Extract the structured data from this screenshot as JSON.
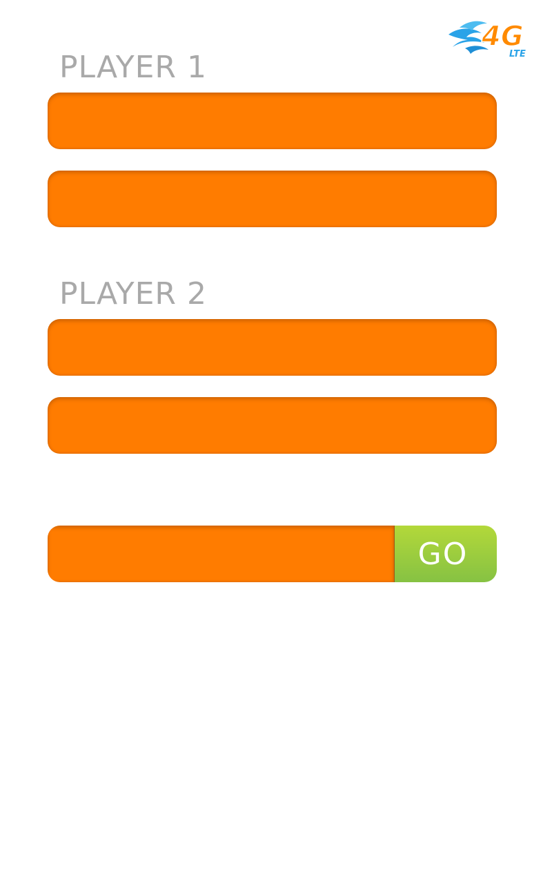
{
  "status": {
    "network_badge_text": "4G",
    "network_badge_subtext": "LTE",
    "network_badge_icon": "4g-lte-icon"
  },
  "player1": {
    "label": "PLAYER 1",
    "field_1_value": "",
    "field_2_value": ""
  },
  "player2": {
    "label": "PLAYER 2",
    "field_1_value": "",
    "field_2_value": ""
  },
  "action": {
    "input_value": "",
    "go_label": "GO"
  },
  "colors": {
    "field_orange": "#ff7c00",
    "go_green_top": "#b3d83a",
    "go_green_bottom": "#86c243",
    "label_gray": "#a9a9a9",
    "badge_blue": "#2aa3e8",
    "badge_orange": "#ff8a00"
  }
}
